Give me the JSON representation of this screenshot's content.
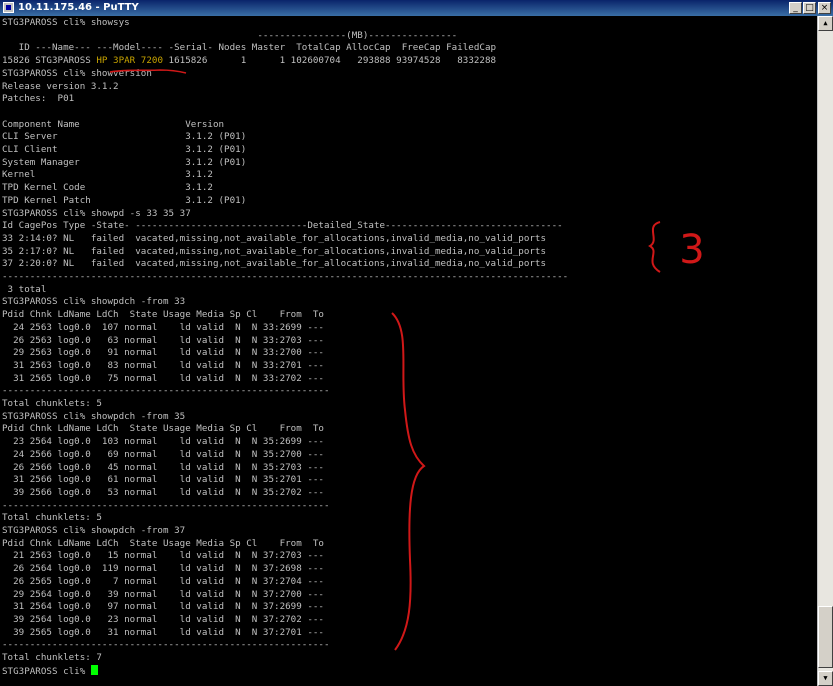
{
  "window": {
    "title": "10.11.175.46 - PuTTY",
    "buttons": {
      "minimize": "_",
      "maximize": "□",
      "close": "×"
    }
  },
  "terminal": {
    "lines": [
      "STG3PAROSS cli% showsys",
      "                                              ----------------(MB)----------------",
      "   ID ---Name--- ---Model---- -Serial- Nodes Master  TotalCap AllocCap  FreeCap FailedCap",
      "15826 STG3PAROSS HP_3PAR_7200 1615826      1      1 102600704   293888 93974528   8332288",
      "STG3PAROSS cli% showversion",
      "Release version 3.1.2",
      "Patches:  P01",
      "",
      "Component Name                   Version",
      "CLI Server                       3.1.2 (P01)",
      "CLI Client                       3.1.2 (P01)",
      "System Manager                   3.1.2 (P01)",
      "Kernel                           3.1.2",
      "TPD Kernel Code                  3.1.2",
      "TPD Kernel Patch                 3.1.2 (P01)",
      "STG3PAROSS cli% showpd -s 33 35 37",
      "Id CagePos Type -State- -------------------------------Detailed_State--------------------------------",
      "33 2:14:0? NL   failed  vacated,missing,not_available_for_allocations,invalid_media,no_valid_ports",
      "35 2:17:0? NL   failed  vacated,missing,not_available_for_allocations,invalid_media,no_valid_ports",
      "37 2:20:0? NL   failed  vacated,missing,not_available_for_allocations,invalid_media,no_valid_ports",
      "------------------------------------------------------------------------------------------------------",
      " 3 total",
      "STG3PAROSS cli% showpdch -from 33",
      "Pdid Chnk LdName LdCh  State Usage Media Sp Cl    From  To",
      "  24 2563 log0.0  107 normal    ld valid  N  N 33:2699 ---",
      "  26 2563 log0.0   63 normal    ld valid  N  N 33:2703 ---",
      "  29 2563 log0.0   91 normal    ld valid  N  N 33:2700 ---",
      "  31 2563 log0.0   83 normal    ld valid  N  N 33:2701 ---",
      "  31 2565 log0.0   75 normal    ld valid  N  N 33:2702 ---",
      "-----------------------------------------------------------",
      "Total chunklets: 5",
      "STG3PAROSS cli% showpdch -from 35",
      "Pdid Chnk LdName LdCh  State Usage Media Sp Cl    From  To",
      "  23 2564 log0.0  103 normal    ld valid  N  N 35:2699 ---",
      "  24 2566 log0.0   69 normal    ld valid  N  N 35:2700 ---",
      "  26 2566 log0.0   45 normal    ld valid  N  N 35:2703 ---",
      "  31 2566 log0.0   61 normal    ld valid  N  N 35:2701 ---",
      "  39 2566 log0.0   53 normal    ld valid  N  N 35:2702 ---",
      "-----------------------------------------------------------",
      "Total chunklets: 5",
      "STG3PAROSS cli% showpdch -from 37",
      "Pdid Chnk LdName LdCh  State Usage Media Sp Cl    From  To",
      "  21 2563 log0.0   15 normal    ld valid  N  N 37:2703 ---",
      "  26 2564 log0.0  119 normal    ld valid  N  N 37:2698 ---",
      "  26 2565 log0.0    7 normal    ld valid  N  N 37:2704 ---",
      "  29 2564 log0.0   39 normal    ld valid  N  N 37:2700 ---",
      "  31 2564 log0.0   97 normal    ld valid  N  N 37:2699 ---",
      "  39 2564 log0.0   23 normal    ld valid  N  N 37:2702 ---",
      "  39 2565 log0.0   31 normal    ld valid  N  N 37:2701 ---",
      "-----------------------------------------------------------",
      "Total chunklets: 7",
      "STG3PAROSS cli% "
    ],
    "highlight": {
      "line_index": 3,
      "prefix": "15826 STG3PAROSS ",
      "text": "HP 3PAR 7200",
      "suffix": " 1615826      1      1 102600704   293888 93974528   8332288"
    }
  },
  "annotation": {
    "label": "3",
    "color": "#d01818"
  }
}
